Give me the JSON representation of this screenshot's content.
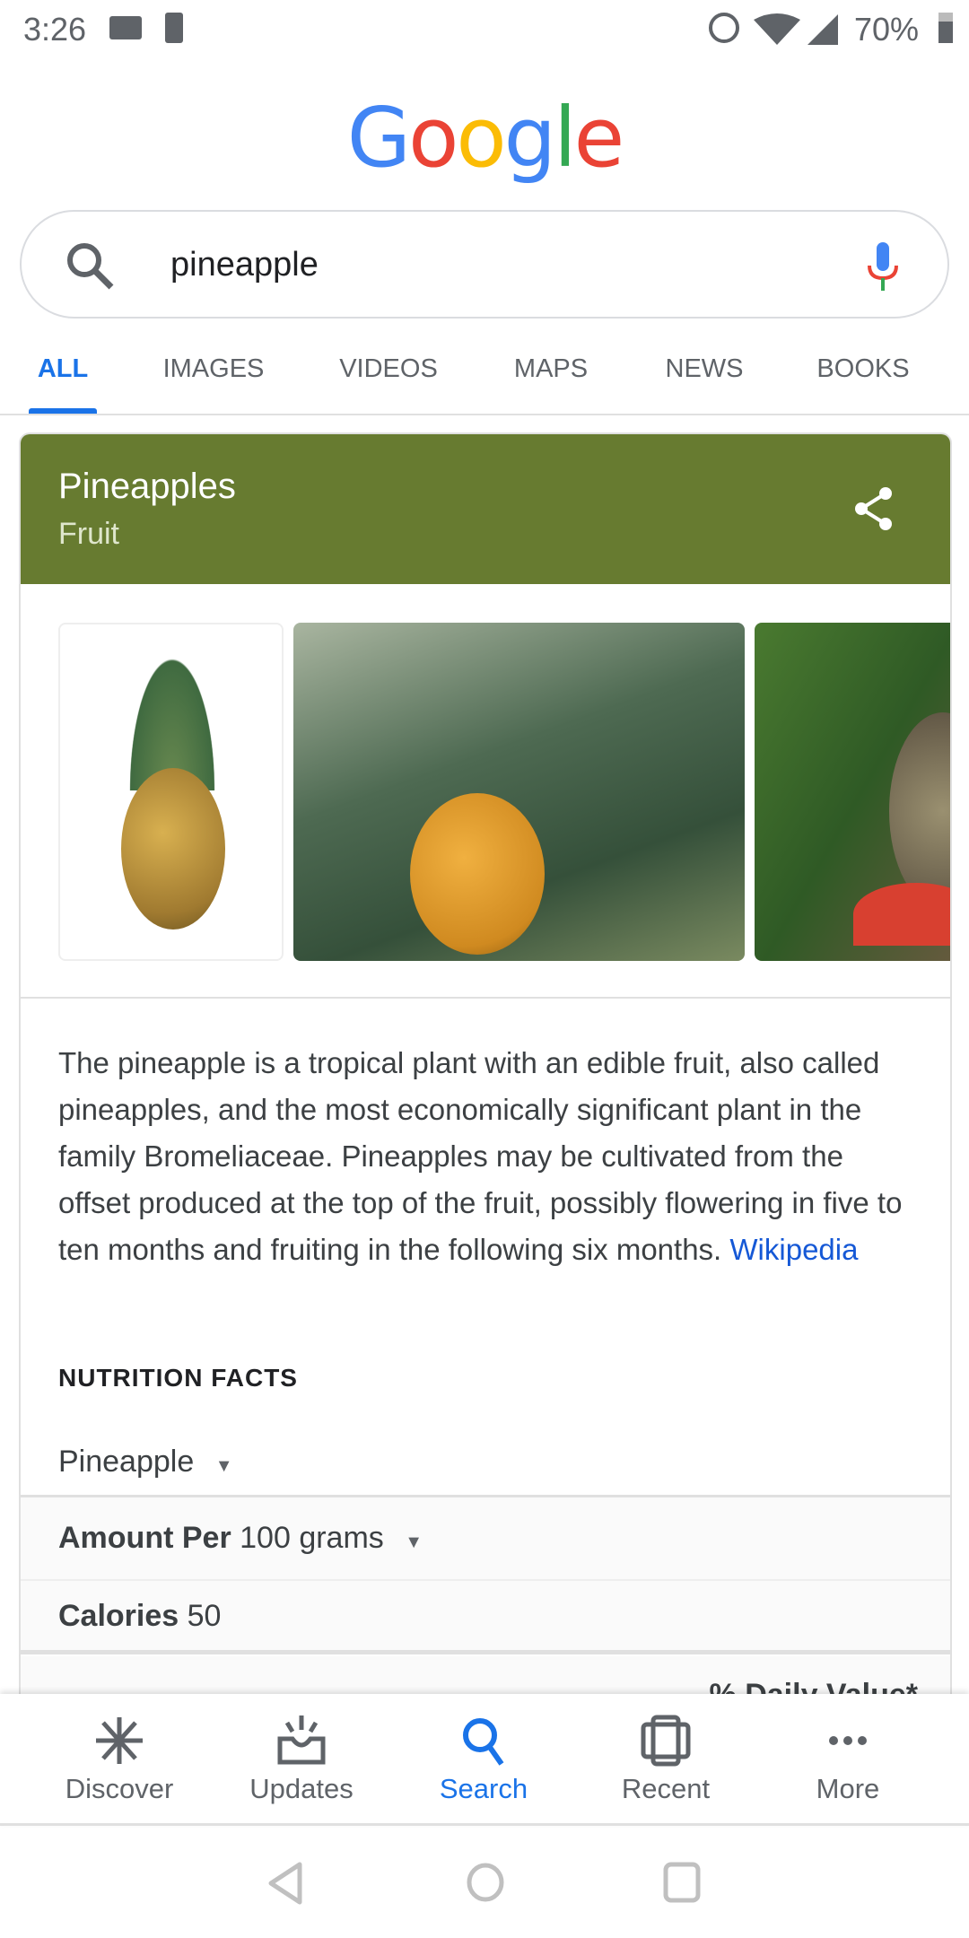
{
  "status_bar": {
    "time": "3:26",
    "battery": "70%"
  },
  "logo": "Google",
  "search": {
    "query": "pineapple"
  },
  "tabs": [
    {
      "label": "ALL",
      "active": true
    },
    {
      "label": "IMAGES"
    },
    {
      "label": "VIDEOS"
    },
    {
      "label": "MAPS"
    },
    {
      "label": "NEWS"
    },
    {
      "label": "BOOKS"
    }
  ],
  "card": {
    "title": "Pineapples",
    "subtitle": "Fruit",
    "header_color": "#677b30",
    "description": "The pineapple is a tropical plant with an edible fruit, also called pineapples, and the most economically significant plant in the family Bromeliaceae. Pineapples may be cultivated from the offset produced at the top of the fruit, possibly flowering in five to ten months and fruiting in the following six months.",
    "source_link": "Wikipedia",
    "nutrition": {
      "heading": "NUTRITION FACTS",
      "food_select": "Pineapple",
      "amount_label": "Amount Per",
      "amount_value": "100 grams",
      "calories_label": "Calories",
      "calories_value": "50",
      "daily_value": "% Daily Value*"
    }
  },
  "bottom_nav": [
    {
      "label": "Discover",
      "icon": "asterisk-icon"
    },
    {
      "label": "Updates",
      "icon": "inbox-icon"
    },
    {
      "label": "Search",
      "icon": "search-icon",
      "active": true
    },
    {
      "label": "Recent",
      "icon": "recent-icon"
    },
    {
      "label": "More",
      "icon": "more-icon"
    }
  ],
  "accent": "#1a73e8"
}
